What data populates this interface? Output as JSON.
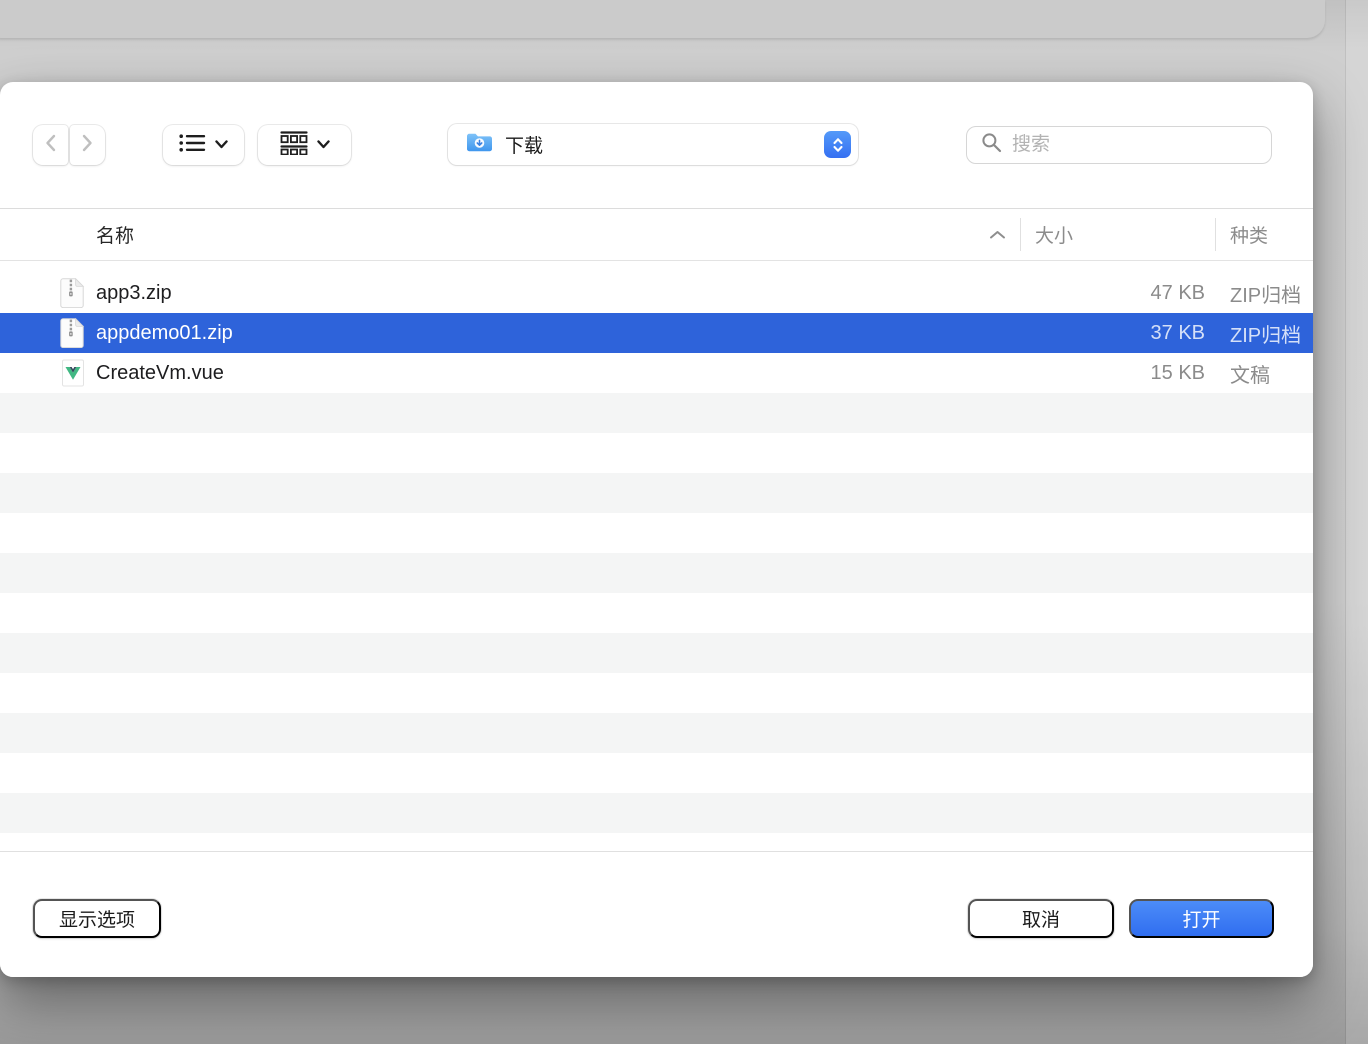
{
  "window": {
    "toolbar": {
      "back_icon": "chevron-left",
      "forward_icon": "chevron-right",
      "view_list_button": "list-view",
      "view_group_button": "group-view",
      "location": {
        "label": "下载",
        "icon": "downloads-folder"
      },
      "search": {
        "placeholder": "搜索"
      }
    },
    "table": {
      "columns": [
        {
          "id": "name",
          "label": "名称",
          "sorted": "asc"
        },
        {
          "id": "size",
          "label": "大小"
        },
        {
          "id": "kind",
          "label": "种类"
        }
      ],
      "rows": [
        {
          "name": "app3.zip",
          "size": "47 KB",
          "kind": "ZIP归档",
          "icon": "zip",
          "selected": false
        },
        {
          "name": "appdemo01.zip",
          "size": "37 KB",
          "kind": "ZIP归档",
          "icon": "zip",
          "selected": true
        },
        {
          "name": "CreateVm.vue",
          "size": "15 KB",
          "kind": "文稿",
          "icon": "vue",
          "selected": false
        }
      ]
    },
    "footer": {
      "show_options_label": "显示选项",
      "cancel_label": "取消",
      "open_label": "打开"
    },
    "colors": {
      "selection_blue": "#2e63da",
      "open_button_blue": "#3d7bf4",
      "stepper_blue": "#3e7cf6",
      "stripe_gray": "#f4f5f5"
    }
  }
}
